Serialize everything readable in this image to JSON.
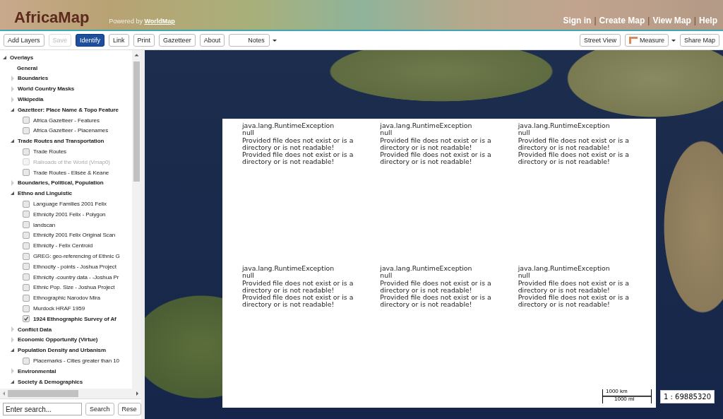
{
  "header": {
    "logo": "AfricaMap",
    "powered_prefix": "Powered by",
    "powered_link": "WorldMap",
    "nav": [
      {
        "kind": "link",
        "label": "Sign in"
      },
      {
        "kind": "separator",
        "label": "|"
      },
      {
        "kind": "link",
        "label": "Create Map"
      },
      {
        "kind": "separator",
        "label": "|"
      },
      {
        "kind": "link",
        "label": "View Map"
      },
      {
        "kind": "separator",
        "label": "|"
      },
      {
        "kind": "link",
        "label": "Help"
      }
    ]
  },
  "toolbar": {
    "left": [
      {
        "kind": "button",
        "label": "Add Layers",
        "disabled": false,
        "selected": false
      },
      {
        "kind": "button",
        "label": "Save",
        "disabled": true,
        "selected": false
      },
      {
        "kind": "button",
        "label": "Identify",
        "disabled": false,
        "selected": true
      },
      {
        "kind": "button",
        "label": "Link",
        "disabled": false,
        "selected": false
      },
      {
        "kind": "button",
        "label": "Print",
        "disabled": false,
        "selected": false
      },
      {
        "kind": "button",
        "label": "Gazetteer",
        "disabled": false,
        "selected": false
      },
      {
        "kind": "button",
        "label": "About",
        "disabled": false,
        "selected": false
      },
      {
        "kind": "menu",
        "label": "Notes",
        "disabled": false,
        "selected": false
      }
    ],
    "right": [
      {
        "kind": "button",
        "label": "Street View",
        "disabled": false,
        "selected": false
      },
      {
        "kind": "measure",
        "label": "Measure",
        "disabled": false,
        "selected": false
      },
      {
        "kind": "button",
        "label": "Share Map",
        "disabled": false,
        "selected": false
      }
    ]
  },
  "tree": {
    "label": "Overlays",
    "expanded": true,
    "children": [
      {
        "kind": "heading",
        "label": "General"
      },
      {
        "kind": "folder",
        "label": "Boundaries",
        "expanded": false
      },
      {
        "kind": "folder",
        "label": "World Country Masks",
        "expanded": false
      },
      {
        "kind": "folder",
        "label": "Wikipedia",
        "expanded": false
      },
      {
        "kind": "folder",
        "label": "Gazetteer: Place Name & Topo Feature",
        "expanded": true,
        "children": [
          {
            "kind": "layer",
            "label": "Africa Gazetteer - Features",
            "checked": false,
            "disabled": false
          },
          {
            "kind": "layer",
            "label": "Africa Gazetteer - Placenames",
            "checked": false,
            "disabled": false
          }
        ]
      },
      {
        "kind": "folder",
        "label": "Trade Routes and Transportation",
        "expanded": true,
        "children": [
          {
            "kind": "layer",
            "label": "Trade Routes",
            "checked": false,
            "disabled": false
          },
          {
            "kind": "layer",
            "label": "Railroads of the World (Vmap0)",
            "checked": false,
            "disabled": true
          },
          {
            "kind": "layer",
            "label": "Trade Routes - Elisée & Keane",
            "checked": false,
            "disabled": false
          }
        ]
      },
      {
        "kind": "folder",
        "label": "Boundaries, Political, Population",
        "expanded": false
      },
      {
        "kind": "folder",
        "label": "Ethno and Linguistic",
        "expanded": true,
        "children": [
          {
            "kind": "layer",
            "label": "Language Families 2001 Felix",
            "checked": false,
            "disabled": false
          },
          {
            "kind": "layer",
            "label": "Ethnicity 2001 Felix - Polygon",
            "checked": false,
            "disabled": false
          },
          {
            "kind": "layer",
            "label": "landscan",
            "checked": false,
            "disabled": false
          },
          {
            "kind": "layer",
            "label": "Ethnicity 2001 Felix Original Scan",
            "checked": false,
            "disabled": false
          },
          {
            "kind": "layer",
            "label": "Ethnicity - Felix Centroid",
            "checked": false,
            "disabled": false
          },
          {
            "kind": "layer",
            "label": "GREG: geo-referencing of Ethnic G",
            "checked": false,
            "disabled": false
          },
          {
            "kind": "layer",
            "label": "Ethnocity - points - Joshua Project",
            "checked": false,
            "disabled": false
          },
          {
            "kind": "layer",
            "label": "Ethnicity -country data - -Joshua Pr",
            "checked": false,
            "disabled": false
          },
          {
            "kind": "layer",
            "label": "Ethnic Pop. Size - Joshua Project",
            "checked": false,
            "disabled": false
          },
          {
            "kind": "layer",
            "label": "Ethnographic Narodov Mira",
            "checked": false,
            "disabled": false
          },
          {
            "kind": "layer",
            "label": "Murdock HRAF 1959",
            "checked": false,
            "disabled": false
          },
          {
            "kind": "layer",
            "label": "1924 Ethnographic Survey of Af",
            "checked": true,
            "disabled": false
          }
        ]
      },
      {
        "kind": "folder",
        "label": "Conflict Data",
        "expanded": false
      },
      {
        "kind": "folder",
        "label": "Economic Opportunity (Virtue)",
        "expanded": false
      },
      {
        "kind": "folder",
        "label": "Population Density and Urbanism",
        "expanded": true,
        "children": [
          {
            "kind": "layer",
            "label": "Placemarks - Cities greater than 10",
            "checked": false,
            "disabled": false
          }
        ]
      },
      {
        "kind": "folder",
        "label": "Environmental",
        "expanded": false
      },
      {
        "kind": "folder",
        "label": "Society & Demographics",
        "expanded": true
      }
    ]
  },
  "search": {
    "placeholder": "Enter search...",
    "buttons": [
      "Search",
      "Rese"
    ]
  },
  "tiles": [
    {
      "lines": [
        "java.lang.RuntimeException",
        "null",
        "Provided file does not exist or is a directory or is not readable!",
        "Provided file does not exist or is a directory or is not readable!"
      ]
    },
    {
      "lines": [
        "java.lang.RuntimeException",
        "null",
        "Provided file does not exist or is a directory or is not readable!",
        "Provided file does not exist or is a directory or is not readable!"
      ]
    },
    {
      "lines": [
        "java.lang.RuntimeException",
        "null",
        "Provided file does not exist or is a directory or is not readable!",
        "Provided file does not exist or is a directory or is not readable!"
      ]
    },
    {
      "lines": [
        "java.lang.RuntimeException",
        "null",
        "Provided file does not exist or is a directory or is not readable!",
        "Provided file does not exist or is a directory or is not readable!"
      ]
    },
    {
      "lines": [
        "java.lang.RuntimeException",
        "null",
        "Provided file does not exist or is a directory or is not readable!",
        "Provided file does not exist or is a directory or is not readable!"
      ]
    },
    {
      "lines": [
        "java.lang.RuntimeException",
        "null",
        "Provided file does not exist or is a directory or is not readable!",
        "Provided file does not exist or is a directory or is not readable!"
      ]
    }
  ],
  "scale": {
    "km": "1000 km",
    "mi": "1000 mi",
    "ratio": "1 : 69885320"
  }
}
